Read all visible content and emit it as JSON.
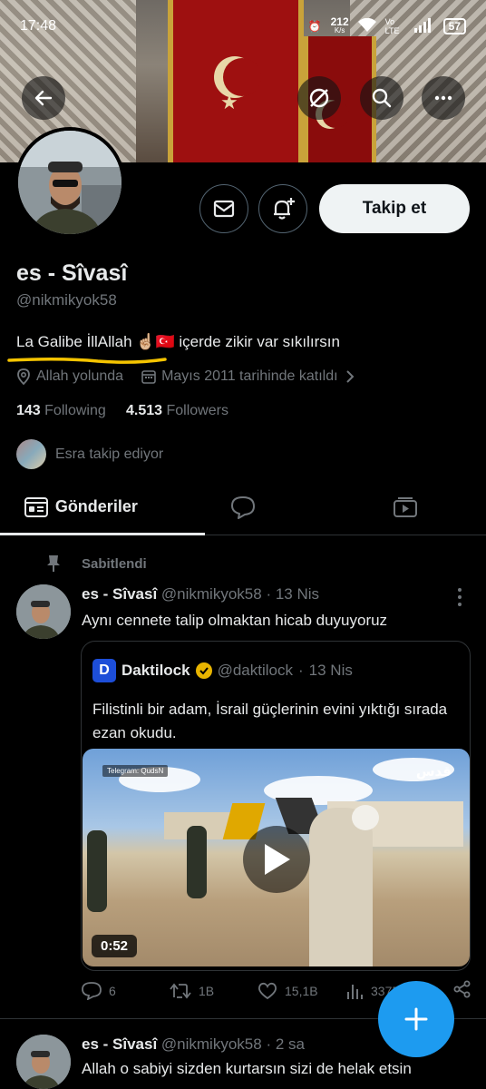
{
  "status_bar": {
    "time": "17:48",
    "speed": "212",
    "speed_unit": "K/s",
    "network": "Vo LTE",
    "battery": "57"
  },
  "profile": {
    "name": "es - Sîvasî",
    "handle": "@nikmikyok58",
    "bio": "La Galibe İllAllah ☝🏼🇹🇷 içerde zikir var sıkılırsın",
    "location": "Allah yolunda",
    "joined": "Mayıs 2011 tarihinde katıldı",
    "following_count": "143",
    "following_label": "Following",
    "followers_count": "4.513",
    "followers_label": "Followers",
    "followed_by": "Esra takip ediyor",
    "follow_button": "Takip et"
  },
  "tabs": [
    {
      "label": "Gönderiler",
      "icon": "posts-icon",
      "active": true
    },
    {
      "label": "",
      "icon": "reply-icon",
      "active": false
    },
    {
      "label": "",
      "icon": "media-icon",
      "active": false
    }
  ],
  "pinned_label": "Sabitlendi",
  "tweets": [
    {
      "name": "es - Sîvasî",
      "handle": "@nikmikyok58",
      "time": "13 Nis",
      "text": "Aynı cennete talip olmaktan hicab duyuyoruz",
      "quote": {
        "logo": "D",
        "name": "Daktilock",
        "handle": "@daktilock",
        "time": "13 Nis",
        "text": "Filistinli bir adam, İsrail güçlerinin evini yıktığı sırada ezan okudu.",
        "video_duration": "0:52",
        "telegram_tag": "Telegram: QudsN",
        "watermark": "قدس"
      },
      "replies": "6",
      "retweets": "1B",
      "likes": "15,1B",
      "views": "337B"
    },
    {
      "name": "es - Sîvasî",
      "handle": "@nikmikyok58",
      "time": "2 sa",
      "text": "Allah o sabiyi sizden kurtarsın sizi de helak etsin"
    }
  ],
  "colors": {
    "background": "#000000",
    "accent": "#1d9bf0",
    "secondary_text": "#71767b",
    "highlight_underline": "#f5c400"
  }
}
